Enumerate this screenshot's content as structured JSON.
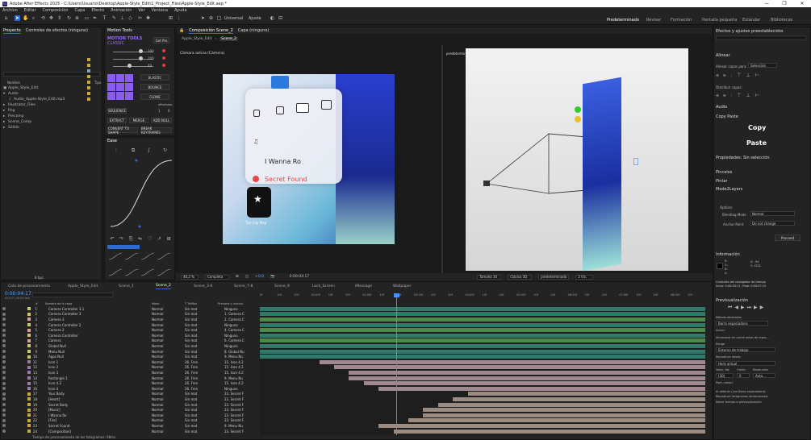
{
  "window": {
    "title": "Adobe After Effects 2025 - C:\\Users\\Usuario\\Desktop\\Apple-Style_Edit\\1_Project_Files\\Apple-Style_Edit.aep *",
    "controls": [
      "—",
      "❐",
      "✕"
    ]
  },
  "menu": [
    "Archivo",
    "Editar",
    "Composición",
    "Capa",
    "Efecto",
    "Animación",
    "Ver",
    "Ventana",
    "Ayuda"
  ],
  "toolbar": {
    "universal": "Universal",
    "ajuste": "Ajuste"
  },
  "workspaces": [
    "Predeterminado",
    "Revisar",
    "Formación",
    "Pantalla pequeña",
    "Estándar",
    "Bibliotecas"
  ],
  "project": {
    "title": "Proyecto",
    "controls": "Controles de efectos (ninguno)",
    "col_name": "Nombre",
    "col_type": "Tipo",
    "footer_bpc": "8 bpc",
    "items": [
      {
        "name": "Apple_Style_Edit",
        "color": "#c9a93c"
      },
      {
        "name": "Audio",
        "color": "#c9a93c"
      },
      {
        "name": "Audio_Apple-Style_Edit.mp3",
        "color": "#7aa6c2"
      },
      {
        "name": "Illustrator_Files",
        "color": "#c9a93c"
      },
      {
        "name": "Png",
        "color": "#c9a93c"
      },
      {
        "name": "Precomp",
        "color": "#c9a93c"
      },
      {
        "name": "Scene_Comp",
        "color": "#c9a93c"
      },
      {
        "name": "Sólido",
        "color": "#c9a93c"
      }
    ]
  },
  "motion_tools": {
    "title": "Motion Tools",
    "brand1": "MOTION TOOLS",
    "brand2": "CLASSIC",
    "get_pro": "Get Pro",
    "values": [
      "100",
      "100",
      "40"
    ],
    "buttons": [
      "ELASTIC",
      "BOUNCE",
      "CLONE",
      "SEQUENCE",
      "EXTRACT",
      "MERGE",
      "ADD NULL",
      "CONVERT TO SHAPE",
      "BREAK KEYFRAMES"
    ],
    "offset": "offset",
    "step": "step",
    "offset_val": "1",
    "step_val": "0"
  },
  "ease": {
    "title": "Ease"
  },
  "viewer": {
    "tab": "Composición Scene_2",
    "layer_tab": "Capa (ninguno)",
    "crumb1": "Apple_Style_Edit",
    "crumb2": "Scene_2",
    "camera_label": "Cámara activa (Cámera)",
    "right_label": "predeterminado",
    "zoom": "46,2 %",
    "quality": "Completa",
    "time": "0:00:04:17",
    "color_val": "+0,0",
    "renderer": "Clásico 3D",
    "view": "predeterminado",
    "views": "2 Vis.",
    "size": "Tamaño 30"
  },
  "ui_card": {
    "song": "I Wanna Ro",
    "secret": "Secret Found",
    "app_label": "The City Map"
  },
  "timeline": {
    "tabs": [
      "Cola de procesamiento",
      "Apple_Style_Edit",
      "Scene_1",
      "Scene_2",
      "Scene_3-6",
      "Scene_7-8",
      "Scene_9",
      "Lock_Screen",
      "iMessage",
      "Wallpaper"
    ],
    "current_time": "0:00:04:17",
    "fps": "00137 (30.00 fps)",
    "headers": {
      "num": "#",
      "name": "Nombre de la capa",
      "mode": "Modo",
      "trkmat": "T TrkMat",
      "parent": "Primario y vínculo"
    },
    "ruler": [
      "0f",
      "10f",
      "20f",
      "01:00f",
      "10f",
      "20f",
      "02:00f",
      "10f",
      "20f",
      "03:00f",
      "10f",
      "20f",
      "04:00f",
      "10f",
      "20f",
      "05:00f",
      "10f",
      "20f",
      "06:00f",
      "10f",
      "20f",
      "07:00f",
      "10f",
      "20f",
      "08:00f",
      "10f"
    ],
    "footer": "Tiempo de procesamiento de los fotogramas: 98ms",
    "layers": [
      {
        "n": "1",
        "name": "Camera Controller 3.1",
        "mode": "Normal",
        "pm": "Sin mat",
        "par": "Ninguno",
        "c": "#c9c96a"
      },
      {
        "n": "2",
        "name": "Camera Controller 3",
        "mode": "Normal",
        "pm": "Sin mat",
        "par": "1. Camera C",
        "c": "#c9c96a"
      },
      {
        "n": "3",
        "name": "Camera 3",
        "mode": "Normal",
        "pm": "Sin mat",
        "par": "2. Camera C",
        "c": "#e0a0a0"
      },
      {
        "n": "4",
        "name": "Camera Controller 2",
        "mode": "Normal",
        "pm": "Sin mat",
        "par": "Ninguno",
        "c": "#c9c96a"
      },
      {
        "n": "5",
        "name": "Camera 2",
        "mode": "Normal",
        "pm": "Sin mat",
        "par": "4. Camera C",
        "c": "#e0a0a0"
      },
      {
        "n": "6",
        "name": "Camera Controller",
        "mode": "Normal",
        "pm": "Sin mat",
        "par": "Ninguno",
        "c": "#c9c96a"
      },
      {
        "n": "7",
        "name": "Camera",
        "mode": "Normal",
        "pm": "Sin mat",
        "par": "6. Camera C",
        "c": "#e0a0a0"
      },
      {
        "n": "8",
        "name": "Global Null",
        "mode": "Normal",
        "pm": "Sin mat",
        "par": "Ninguno",
        "c": "#c9c96a"
      },
      {
        "n": "9",
        "name": "Menu Null",
        "mode": "Normal",
        "pm": "Sin mat",
        "par": "8. Global Nu",
        "c": "#c9c96a"
      },
      {
        "n": "10",
        "name": "Apps Null",
        "mode": "Normal",
        "pm": "Sin mat",
        "par": "9. Menu Nu",
        "c": "#c9c96a"
      },
      {
        "n": "11",
        "name": "Icon 1",
        "mode": "Normal",
        "pm": "26. Fren",
        "par": "15. Icon 4.2",
        "c": "#9a7aa8"
      },
      {
        "n": "12",
        "name": "Icon 2",
        "mode": "Normal",
        "pm": "26. Fren",
        "par": "15. Icon 4.2",
        "c": "#9a7aa8"
      },
      {
        "n": "13",
        "name": "Icon 3",
        "mode": "Normal",
        "pm": "26. Fren",
        "par": "15. Icon 4.2",
        "c": "#9a7aa8"
      },
      {
        "n": "14",
        "name": "Rectangle 1",
        "mode": "Normal",
        "pm": "26. Fren",
        "par": "9. Menu Nu",
        "c": "#9a7aa8"
      },
      {
        "n": "15",
        "name": "Icon 4.2",
        "mode": "Normal",
        "pm": "26. Fren",
        "par": "15. Icon 4.2",
        "c": "#9a7aa8"
      },
      {
        "n": "16",
        "name": "Icon 4",
        "mode": "Normal",
        "pm": "26. Fren",
        "par": "Ninguno",
        "c": "#9a7aa8"
      },
      {
        "n": "17",
        "name": "Your Body",
        "mode": "Normal",
        "pm": "Sin mat",
        "par": "23. Secret F",
        "c": "#c9a93c"
      },
      {
        "n": "18",
        "name": "[Heart]",
        "mode": "Normal",
        "pm": "Sin mat",
        "par": "23. Secret F",
        "c": "#c9a93c"
      },
      {
        "n": "19",
        "name": "Secret Body",
        "mode": "Normal",
        "pm": "Sin mat",
        "par": "23. Secret F",
        "c": "#c9a93c"
      },
      {
        "n": "20",
        "name": "[Music]",
        "mode": "Normal",
        "pm": "Sin mat",
        "par": "23. Secret F",
        "c": "#c9a93c"
      },
      {
        "n": "21",
        "name": "I Wanna Ro",
        "mode": "Normal",
        "pm": "Sin mat",
        "par": "23. Secret F",
        "c": "#c9a93c"
      },
      {
        "n": "22",
        "name": "[Fire]",
        "mode": "Normal",
        "pm": "Sin mat",
        "par": "23. Secret F",
        "c": "#c9a93c"
      },
      {
        "n": "23",
        "name": "Secret Found",
        "mode": "Normal",
        "pm": "Sin mat",
        "par": "9. Menu Nu",
        "c": "#c9a93c"
      },
      {
        "n": "24",
        "name": "[Composition]",
        "mode": "Normal",
        "pm": "Sin mat",
        "par": "23. Secret F",
        "c": "#c9a93c"
      }
    ]
  },
  "right": {
    "effects_title": "Efectos y ajustes preestablecidos",
    "align": "Alinear",
    "align_to": "Alinear capas para:",
    "selection": "Selección",
    "distribute": "Distribuir capas:",
    "audio": "Audio",
    "copy_paste": "Copy Paste",
    "copy": "Copy",
    "paste": "Paste",
    "props": "Propiedades: Sin selección",
    "pinceles": "Pinceles",
    "pintar": "Pintar",
    "mode_layers": "Mode2Layers",
    "options": "Options",
    "blending": "Blending Mode",
    "blend_val": "Normal",
    "anchor": "Anchor Point",
    "anchor_val": "Do not change",
    "proceed": "Proceed",
    "info": "Información",
    "info_vals": [
      "R:",
      "G:",
      "B:",
      "A:"
    ],
    "coords": [
      "X: -54",
      "Y: 1252"
    ],
    "info_text": "Controles del navegador de tiempo",
    "info_text2": "Inicio: 0:00:03:11, Final: 0:00:07:15",
    "preview": "Previsualización",
    "shortcut": "Método abreviado",
    "shortcut_val": "Barra espaciadora",
    "include": "Incluir:",
    "cache": "Almacenar en caché antes de repro...",
    "range": "Rango",
    "range_val": "Entorno de trabajo",
    "play_from": "Reproducir desde",
    "play_from_val": "Hora actual",
    "fps_label": "Veloc. fot.",
    "skip": "Omitir",
    "res": "Resolución",
    "fps_val": "(30)",
    "skip_val": "0",
    "res_val": "Auto...",
    "fullscreen": "Pant. compl.",
    "stop_label": "Al detener (con Barra espaciadora):",
    "opt1": "Reproducir fotogramas almacenados",
    "opt2": "Mover tiempo a previsualización"
  }
}
